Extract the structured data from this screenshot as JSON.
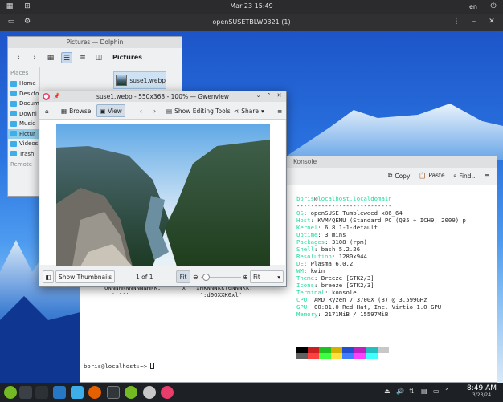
{
  "host": {
    "clock": "Mar 23  15:49",
    "lang": "en",
    "vm_title": "openSUSETBLW0321 (1)"
  },
  "dolphin": {
    "title": "Pictures — Dolphin",
    "breadcrumb": "Pictures",
    "places_header": "Places",
    "places": [
      "Home",
      "Deskto",
      "Docum",
      "Downl",
      "Music",
      "Pictur",
      "Videos",
      "Trash"
    ],
    "remote_header": "Remote",
    "file_name": "suse1.webp"
  },
  "gwenview": {
    "title": "suse1.webp - 550x368 - 100% — Gwenview",
    "browse_label": "Browse",
    "view_label": "View",
    "editing_label": "Show Editing Tools",
    "share_label": "Share",
    "thumbnails_label": "Show Thumbnails",
    "page_counter": "1 of 1",
    "fit_button": "Fit",
    "zoom_select": "Fit"
  },
  "konsole": {
    "title": "Konsole",
    "copy_label": "Copy",
    "paste_label": "Paste",
    "find_label": "Find...",
    "user": "boris",
    "host": "localhost.localdomain",
    "separator": "---------------------------",
    "info": [
      {
        "key": "OS",
        "value": "openSUSE Tumbleweed x86_64"
      },
      {
        "key": "Host",
        "value": "KVM/QEMU (Standard PC (Q35 + ICH9, 2009) p"
      },
      {
        "key": "Kernel",
        "value": "6.8.1-1-default"
      },
      {
        "key": "Uptime",
        "value": "3 mins"
      },
      {
        "key": "Packages",
        "value": "3108 (rpm)"
      },
      {
        "key": "Shell",
        "value": "bash 5.2.26"
      },
      {
        "key": "Resolution",
        "value": "1280x944"
      },
      {
        "key": "DE",
        "value": "Plasma 6.0.2"
      },
      {
        "key": "WM",
        "value": "kwin"
      },
      {
        "key": "Theme",
        "value": "Breeze [GTK2/3]"
      },
      {
        "key": "Icons",
        "value": "breeze [GTK2/3]"
      },
      {
        "key": "Terminal",
        "value": "konsole"
      },
      {
        "key": "CPU",
        "value": "AMD Ryzen 7 3700X (8) @ 3.599GHz"
      },
      {
        "key": "GPU",
        "value": "00:01.0 Red Hat, Inc. Virtio 1.0 GPU"
      },
      {
        "key": "Memory",
        "value": "2171MiB / 15597MiB"
      }
    ],
    "logo_lines": [
      "oNNNNNNNNNNNNNk,      x   xNkNNNkkl0NNNkk;",
      "  '''''                    ':d0OXXK0xl'"
    ],
    "prompt": "boris@localhost:~> ",
    "swatches_top": [
      "#000000",
      "#cc2020",
      "#20c020",
      "#d4b000",
      "#2050d0",
      "#c020c0",
      "#20c0c0",
      "#c8c8c8"
    ],
    "swatches_bottom": [
      "#606060",
      "#ff4040",
      "#40ff40",
      "#ffe040",
      "#4080ff",
      "#ff40ff",
      "#40ffff",
      "#ffffff"
    ]
  },
  "taskbar": {
    "time": "8:49 AM",
    "date": "3/23/24"
  },
  "colors": {
    "accent": "#3daee9",
    "terminal_key": "#1cdc9a"
  }
}
